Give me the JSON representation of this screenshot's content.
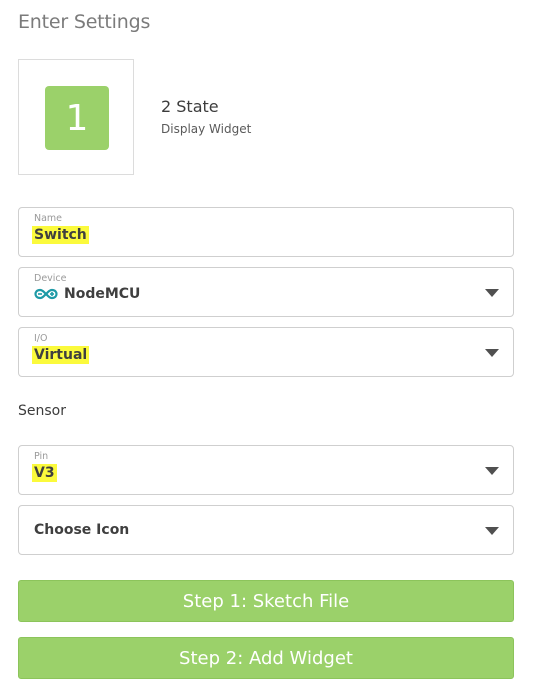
{
  "header": {
    "title": "Enter Settings"
  },
  "widget": {
    "tile_number": "1",
    "name": "2 State",
    "type": "Display Widget",
    "tile_color": "#9bd16a"
  },
  "fields": {
    "name": {
      "label": "Name",
      "value": "Switch"
    },
    "device": {
      "label": "Device",
      "value": "NodeMCU",
      "icon": "infinity-icon",
      "icon_color": "#1e9aa6"
    },
    "io": {
      "label": "I/O",
      "value": "Virtual"
    },
    "pin": {
      "label": "Pin",
      "value": "V3"
    },
    "icon_select": {
      "value": "Choose Icon"
    }
  },
  "sections": {
    "sensor": "Sensor"
  },
  "buttons": {
    "step1": "Step 1: Sketch File",
    "step2": "Step 2: Add Widget"
  },
  "colors": {
    "accent": "#9bd16a",
    "highlight": "#fbfa3c"
  }
}
